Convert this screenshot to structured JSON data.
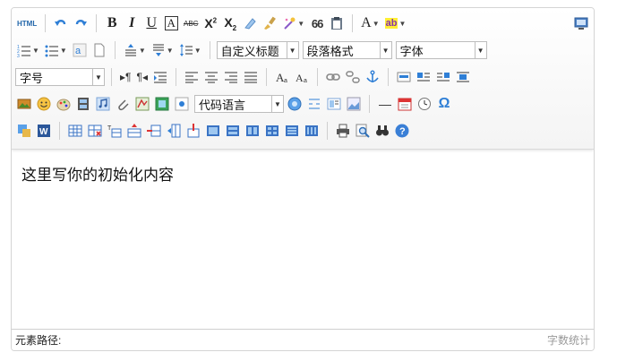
{
  "toolbar": {
    "html_label": "HTML",
    "bold": "B",
    "italic": "I",
    "underline": "U",
    "fontborder": "A",
    "strike": "ABC",
    "superscript": "X",
    "sup_mark": "2",
    "subscript": "X",
    "sub_mark": "2",
    "forecolor": "A",
    "backcolor": "ab",
    "blockquote": "66",
    "pilcrow_ltr": "¶",
    "pilcrow_rtl": "¶",
    "paragraph_combo": "自定义标题",
    "heading_combo": "段落格式",
    "fontfamily_combo": "字体",
    "fontsize_combo": "字号",
    "codelanguage_combo": "代码语言",
    "spechars": "Ω",
    "horizontal": "—"
  },
  "editor": {
    "content": "这里写你的初始化内容"
  },
  "statusbar": {
    "path_label": "元素路径:",
    "word_count": "字数统计"
  },
  "colors": {
    "accent": "#2f7fd6",
    "border": "#d4d4d4",
    "toolbar_bg": "#f4f4f4"
  }
}
